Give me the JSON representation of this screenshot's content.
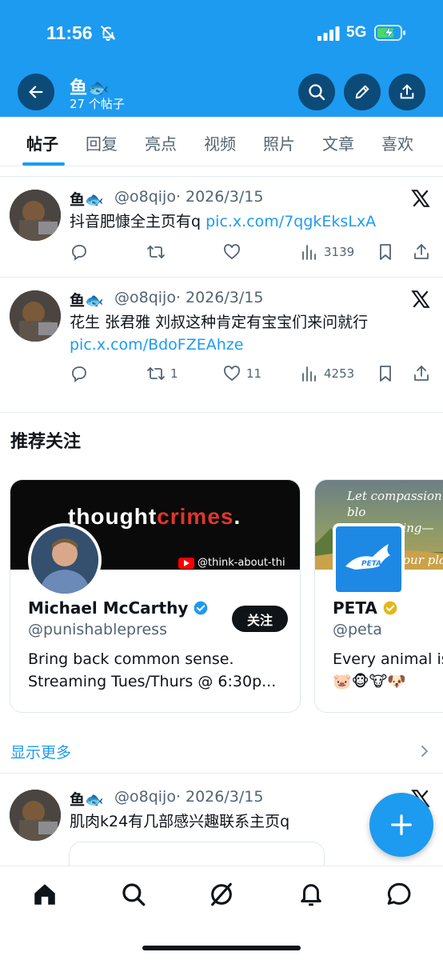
{
  "status_bar": {
    "time": "11:56",
    "network": "5G"
  },
  "header": {
    "name": "鱼🐟",
    "post_count": "27 个帖子"
  },
  "tabs": [
    "帖子",
    "回复",
    "亮点",
    "视频",
    "照片",
    "文章",
    "喜欢"
  ],
  "posts": [
    {
      "name": "鱼🐟",
      "handle": "@o8qijo",
      "date": "2026/3/15",
      "text": "抖音肥慷全主页有q ",
      "link": "pic.x.com/7qgkEksLxA",
      "replies": "",
      "reposts": "",
      "likes": "",
      "views": "3139"
    },
    {
      "name": "鱼🐟",
      "handle": "@o8qijo",
      "date": "2026/3/15",
      "text": "花生 张君雅 刘叔这种肯定有宝宝们来问就行",
      "link": "pic.x.com/BdoFZEAhze",
      "replies": "",
      "reposts": "1",
      "likes": "11",
      "views": "4253"
    },
    {
      "name": "鱼🐟",
      "handle": "@o8qijo",
      "date": "2026/3/15",
      "text": "肌肉k24有几部感兴趣联系主页q",
      "link": ""
    }
  ],
  "recommended": {
    "title": "推荐关注",
    "cards": [
      {
        "banner_text_white": "thought",
        "banner_text_red": "crimes",
        "banner_text_dot": ".",
        "banner_channel": "@think-about-thi",
        "name": "Michael McCarthy",
        "handle": "@punishablepress",
        "bio_line1": "Bring back common sense.",
        "bio_line2": "Streaming Tues/Thurs @ 6:30p...",
        "follow_label": "关注",
        "verified_color": "#1d9bf0"
      },
      {
        "banner_line1": "Let compassion blo",
        "banner_line2": "this spring—leave",
        "banner_line3": "our plate",
        "logo_text": "PETA",
        "name": "PETA",
        "handle": "@peta",
        "bio_line1": "Every animal is",
        "bio_line2": "🐷🐵🐮🐶",
        "verified_color": "#e2b719"
      }
    ],
    "show_more": "显示更多"
  },
  "colors": {
    "accent": "#1d9bf0",
    "header_button": "#0c4a78"
  }
}
